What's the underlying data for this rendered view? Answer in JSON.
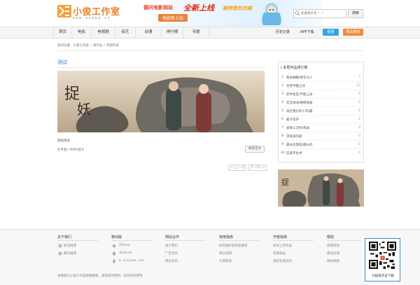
{
  "header": {
    "logo_text": "小俊工作室",
    "logo_sub": "www.xiaoq.cc",
    "banner": {
      "line1": "德问电影网站",
      "big": "全新上线",
      "line3": "期待您的光临",
      "badge": "电影新上线"
    },
    "search": {
      "placeholder": "此查搜片名 \"...\"",
      "button": "搜索"
    }
  },
  "nav": {
    "items": [
      "首页",
      "电影",
      "电视剧",
      "综艺",
      "动漫",
      "排行榜",
      "专题"
    ],
    "history": "历史记录",
    "app": "APP下载",
    "login": "登录",
    "contribute": "网站推荐"
  },
  "breadcrumb": "您的位置：小俊工作室 » 演示站 » 专题列表",
  "topic": {
    "title": "测试",
    "desc": "测试测试",
    "count": "此专题一共有0影片",
    "read_all": "阅读全文"
  },
  "pager": {
    "prev": "<<上一页",
    "next": "下一页>>"
  },
  "ranking": {
    "title": "| 本周作品排行榜",
    "items": [
      {
        "rank": "1",
        "name": "暂本蝴蝶/青年与少",
        "val": "7"
      },
      {
        "rank": "2",
        "name": "华梦半醒之间",
        "val": "13"
      },
      {
        "rank": "3",
        "name": "赤中住定/不能上床",
        "val": "0"
      },
      {
        "rank": "4",
        "name": "恋恋海滩/缠缠海滩",
        "val": "0"
      },
      {
        "rank": "5",
        "name": "再见我们的十年/最",
        "val": "1"
      },
      {
        "rank": "6",
        "name": "栀子花开",
        "val": "2"
      },
      {
        "rank": "7",
        "name": "爱情三次折/病弱",
        "val": "0"
      },
      {
        "rank": "8",
        "name": "求爱操作部",
        "val": "0"
      },
      {
        "rank": "9",
        "name": "最长的旅程/最长的",
        "val": "0"
      },
      {
        "rank": "10",
        "name": "恋爱罗拉术",
        "val": "0"
      }
    ]
  },
  "footer": {
    "columns": [
      {
        "head": "关于我们",
        "links": [
          "新浪微博",
          "腾讯微博"
        ]
      },
      {
        "head": "移动版",
        "links": [
          "iPhone",
          "Android",
          "m.xxiyuan.com"
        ]
      },
      {
        "head": "网站合作",
        "links": [
          "关于我们",
          "广告合作",
          "网址发布"
        ]
      },
      {
        "head": "使用指南",
        "links": [
          "如何摄好影视盗播者",
          "积分说明",
          "片源获取"
        ]
      },
      {
        "head": "作者指南",
        "links": [
          "如何上传作品",
          "获取收益",
          "侵权处理流程"
        ]
      },
      {
        "head": "帮助",
        "links": [
          "获取帮助",
          "建议反馈",
          "网站地图"
        ]
      }
    ],
    "copyright": "本模板为小俊工作室联赛模板，感谢您的使用。欢迎你的使用",
    "qr_caption": "扫描或点击下载"
  }
}
